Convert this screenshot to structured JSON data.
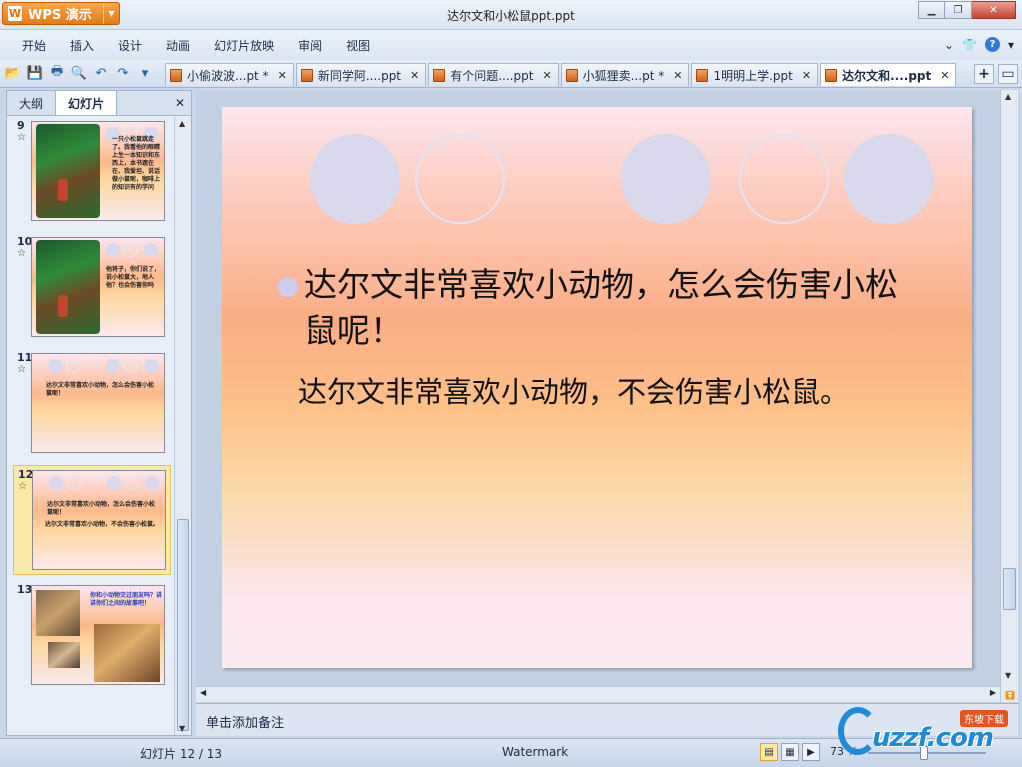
{
  "app": {
    "name": "WPS 演示",
    "logo_glyph": "W"
  },
  "window": {
    "title": "达尔文和小松鼠ppt.ppt"
  },
  "menu": {
    "items": [
      "开始",
      "插入",
      "设计",
      "动画",
      "幻灯片放映",
      "审阅",
      "视图"
    ]
  },
  "doc_tabs": [
    {
      "label": "小偷波波...pt *"
    },
    {
      "label": "新同学阿....ppt"
    },
    {
      "label": "有个问题....ppt"
    },
    {
      "label": "小狐狸卖...pt *"
    },
    {
      "label": "1明明上学.ppt"
    },
    {
      "label": "达尔文和....ppt",
      "active": true
    }
  ],
  "left_panel": {
    "tabs": [
      "大纲",
      "幻灯片"
    ],
    "active_tab": "幻灯片",
    "thumbnails": [
      {
        "num": "9",
        "text": "一只小松鼠跳走了。我看他的眼睛上生一本知识和东西上，本书遮在在、我爱坦、说话做小鼠呢，咖啡上的知识有的学问"
      },
      {
        "num": "10",
        "text": "他将子，你们说了，说小松鼠大，地人他？也会伤害你吗"
      },
      {
        "num": "11",
        "text": "达尔文非常喜欢小动物，怎么会伤害小松鼠呢！"
      },
      {
        "num": "12",
        "text": "达尔文非常喜欢小动物，怎么会伤害小松鼠呢！",
        "text2": "达尔文非常喜欢小动物，不会伤害小松鼠。",
        "selected": true
      },
      {
        "num": "13",
        "text": "你和小动物交过朋友吗？讲讲你们之间的故事吧！"
      }
    ]
  },
  "slide": {
    "main_text": "达尔文非常喜欢小动物，怎么会伤害小松鼠呢！",
    "sub_text": "达尔文非常喜欢小动物，不会伤害小松鼠。"
  },
  "notes": {
    "placeholder": "单击添加备注"
  },
  "status": {
    "slide_counter": "幻灯片 12 / 13",
    "theme": "Watermark",
    "zoom": "73 %"
  },
  "watermark": {
    "text": "uzzf.com",
    "badge": "东坡下载"
  },
  "colors": {
    "accent": "#e57a14",
    "bullet": "#ccccf0",
    "circle": "#d9d8ec"
  }
}
